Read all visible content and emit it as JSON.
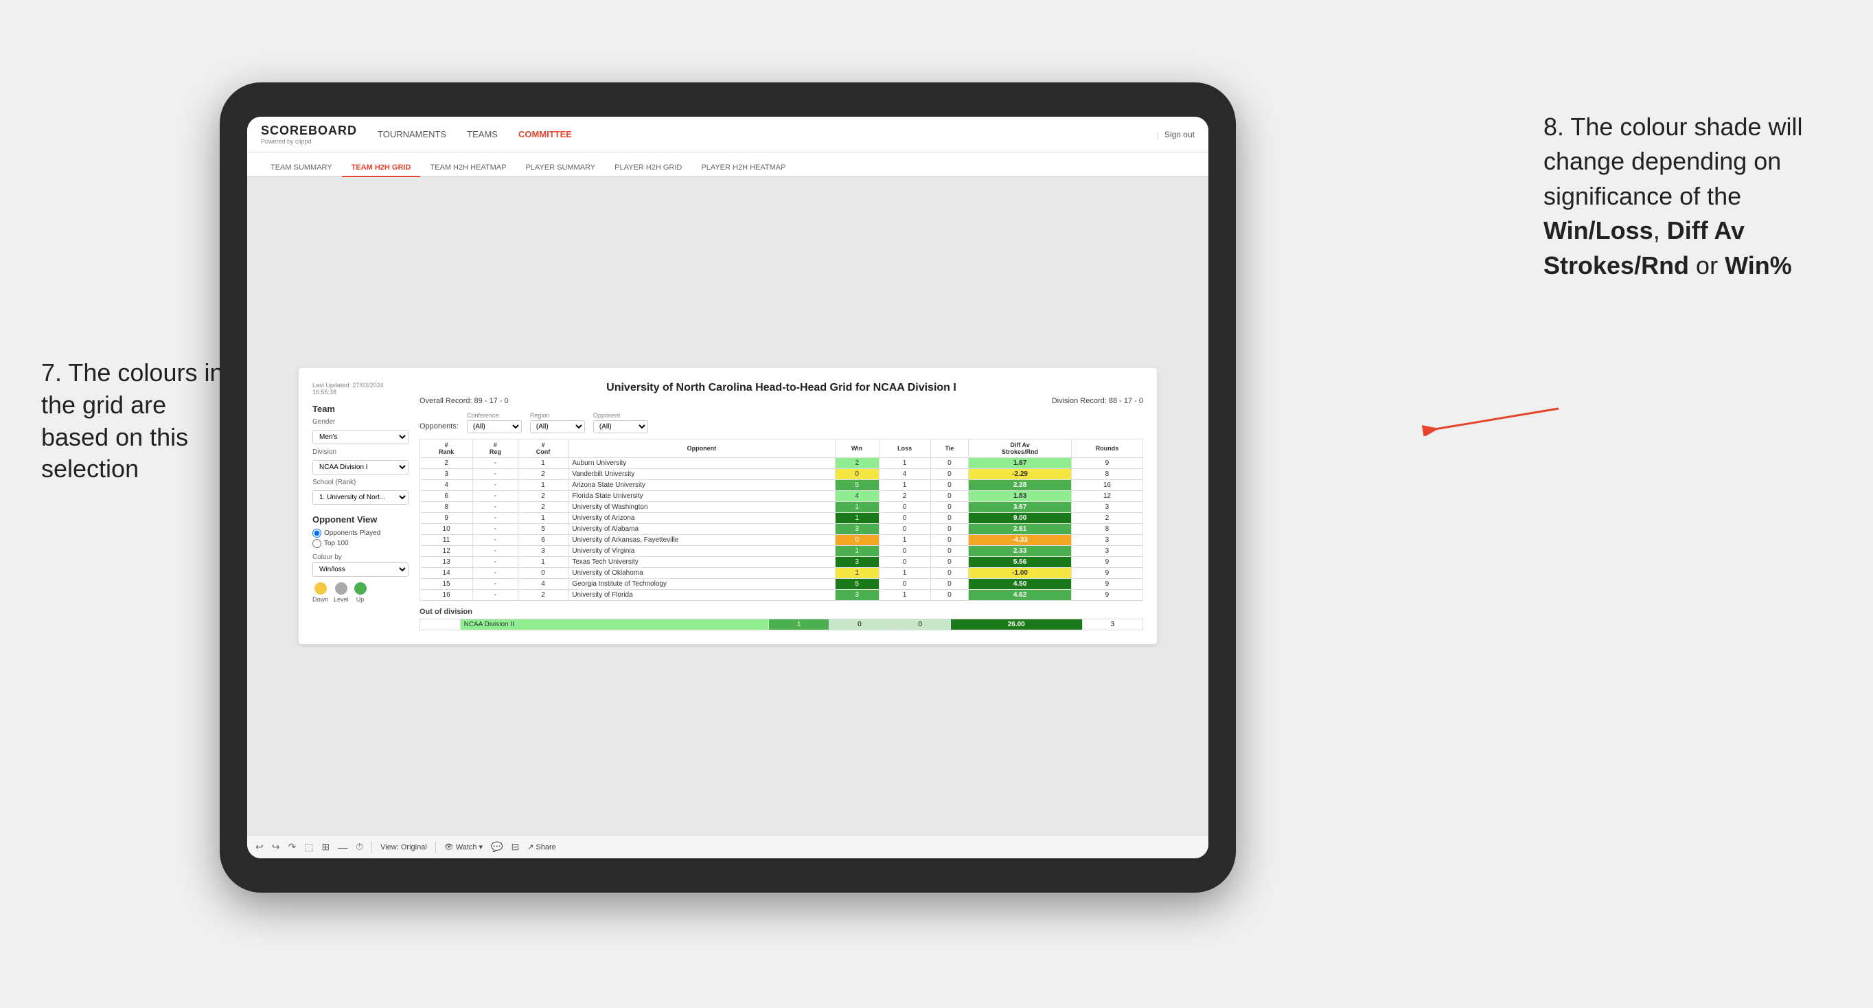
{
  "annotations": {
    "left_text": "7. The colours in the grid are based on this selection",
    "right_text_1": "8. The colour shade will change depending on significance of the ",
    "right_bold_1": "Win/Loss",
    "right_text_2": ", ",
    "right_bold_2": "Diff Av Strokes/Rnd",
    "right_text_3": " or ",
    "right_bold_3": "Win%"
  },
  "nav": {
    "logo": "SCOREBOARD",
    "logo_sub": "Powered by clippd",
    "items": [
      "TOURNAMENTS",
      "TEAMS",
      "COMMITTEE"
    ],
    "sign_out": "Sign out"
  },
  "sub_nav": {
    "items": [
      "TEAM SUMMARY",
      "TEAM H2H GRID",
      "TEAM H2H HEATMAP",
      "PLAYER SUMMARY",
      "PLAYER H2H GRID",
      "PLAYER H2H HEATMAP"
    ],
    "active": "TEAM H2H GRID"
  },
  "left_panel": {
    "last_updated_label": "Last Updated: 27/03/2024",
    "last_updated_time": "16:55:38",
    "team_label": "Team",
    "gender_label": "Gender",
    "gender_value": "Men's",
    "division_label": "Division",
    "division_value": "NCAA Division I",
    "school_label": "School (Rank)",
    "school_value": "1. University of Nort...",
    "opponent_view_label": "Opponent View",
    "radio_1": "Opponents Played",
    "radio_2": "Top 100",
    "colour_by_label": "Colour by",
    "colour_by_value": "Win/loss",
    "dot_labels": [
      "Down",
      "Level",
      "Up"
    ]
  },
  "grid": {
    "title": "University of North Carolina Head-to-Head Grid for NCAA Division I",
    "overall_record": "Overall Record: 89 - 17 - 0",
    "division_record": "Division Record: 88 - 17 - 0",
    "filter_opponents_label": "Opponents:",
    "filter_conf_label": "Conference",
    "filter_conf_value": "(All)",
    "filter_region_label": "Region",
    "filter_region_value": "(All)",
    "filter_opp_label": "Opponent",
    "filter_opp_value": "(All)",
    "col_headers": [
      "#\nRank",
      "#\nReg",
      "#\nConf",
      "Opponent",
      "Win",
      "Loss",
      "Tie",
      "Diff Av\nStrokes/Rnd",
      "Rounds"
    ],
    "rows": [
      {
        "rank": "2",
        "reg": "-",
        "conf": "1",
        "opponent": "Auburn University",
        "win": "2",
        "loss": "1",
        "tie": "0",
        "diff": "1.67",
        "rounds": "9",
        "color": "light-green"
      },
      {
        "rank": "3",
        "reg": "-",
        "conf": "2",
        "opponent": "Vanderbilt University",
        "win": "0",
        "loss": "4",
        "tie": "0",
        "diff": "-2.29",
        "rounds": "8",
        "color": "yellow"
      },
      {
        "rank": "4",
        "reg": "-",
        "conf": "1",
        "opponent": "Arizona State University",
        "win": "5",
        "loss": "1",
        "tie": "0",
        "diff": "2.28",
        "rounds": "16",
        "color": "green"
      },
      {
        "rank": "6",
        "reg": "-",
        "conf": "2",
        "opponent": "Florida State University",
        "win": "4",
        "loss": "2",
        "tie": "0",
        "diff": "1.83",
        "rounds": "12",
        "color": "light-green"
      },
      {
        "rank": "8",
        "reg": "-",
        "conf": "2",
        "opponent": "University of Washington",
        "win": "1",
        "loss": "0",
        "tie": "0",
        "diff": "3.67",
        "rounds": "3",
        "color": "green"
      },
      {
        "rank": "9",
        "reg": "-",
        "conf": "1",
        "opponent": "University of Arizona",
        "win": "1",
        "loss": "0",
        "tie": "0",
        "diff": "9.00",
        "rounds": "2",
        "color": "dark-green"
      },
      {
        "rank": "10",
        "reg": "-",
        "conf": "5",
        "opponent": "University of Alabama",
        "win": "3",
        "loss": "0",
        "tie": "0",
        "diff": "2.61",
        "rounds": "8",
        "color": "green"
      },
      {
        "rank": "11",
        "reg": "-",
        "conf": "6",
        "opponent": "University of Arkansas, Fayetteville",
        "win": "0",
        "loss": "1",
        "tie": "0",
        "diff": "-4.33",
        "rounds": "3",
        "color": "orange"
      },
      {
        "rank": "12",
        "reg": "-",
        "conf": "3",
        "opponent": "University of Virginia",
        "win": "1",
        "loss": "0",
        "tie": "0",
        "diff": "2.33",
        "rounds": "3",
        "color": "green"
      },
      {
        "rank": "13",
        "reg": "-",
        "conf": "1",
        "opponent": "Texas Tech University",
        "win": "3",
        "loss": "0",
        "tie": "0",
        "diff": "5.56",
        "rounds": "9",
        "color": "dark-green"
      },
      {
        "rank": "14",
        "reg": "-",
        "conf": "0",
        "opponent": "University of Oklahoma",
        "win": "1",
        "loss": "1",
        "tie": "0",
        "diff": "-1.00",
        "rounds": "9",
        "color": "yellow"
      },
      {
        "rank": "15",
        "reg": "-",
        "conf": "4",
        "opponent": "Georgia Institute of Technology",
        "win": "5",
        "loss": "0",
        "tie": "0",
        "diff": "4.50",
        "rounds": "9",
        "color": "dark-green"
      },
      {
        "rank": "16",
        "reg": "-",
        "conf": "2",
        "opponent": "University of Florida",
        "win": "3",
        "loss": "1",
        "tie": "0",
        "diff": "4.62",
        "rounds": "9",
        "color": "green"
      }
    ],
    "out_of_division_label": "Out of division",
    "out_row": {
      "label": "NCAA Division II",
      "win": "1",
      "loss": "0",
      "tie": "0",
      "diff": "26.00",
      "rounds": "3"
    }
  },
  "toolbar": {
    "view_label": "View: Original",
    "watch_label": "Watch",
    "share_label": "Share"
  },
  "colors": {
    "accent": "#e8432d",
    "dark_green": "#1a7a1a",
    "med_green": "#4caf50",
    "light_green": "#90ee90",
    "yellow": "#f5e642",
    "orange": "#f5a623"
  }
}
